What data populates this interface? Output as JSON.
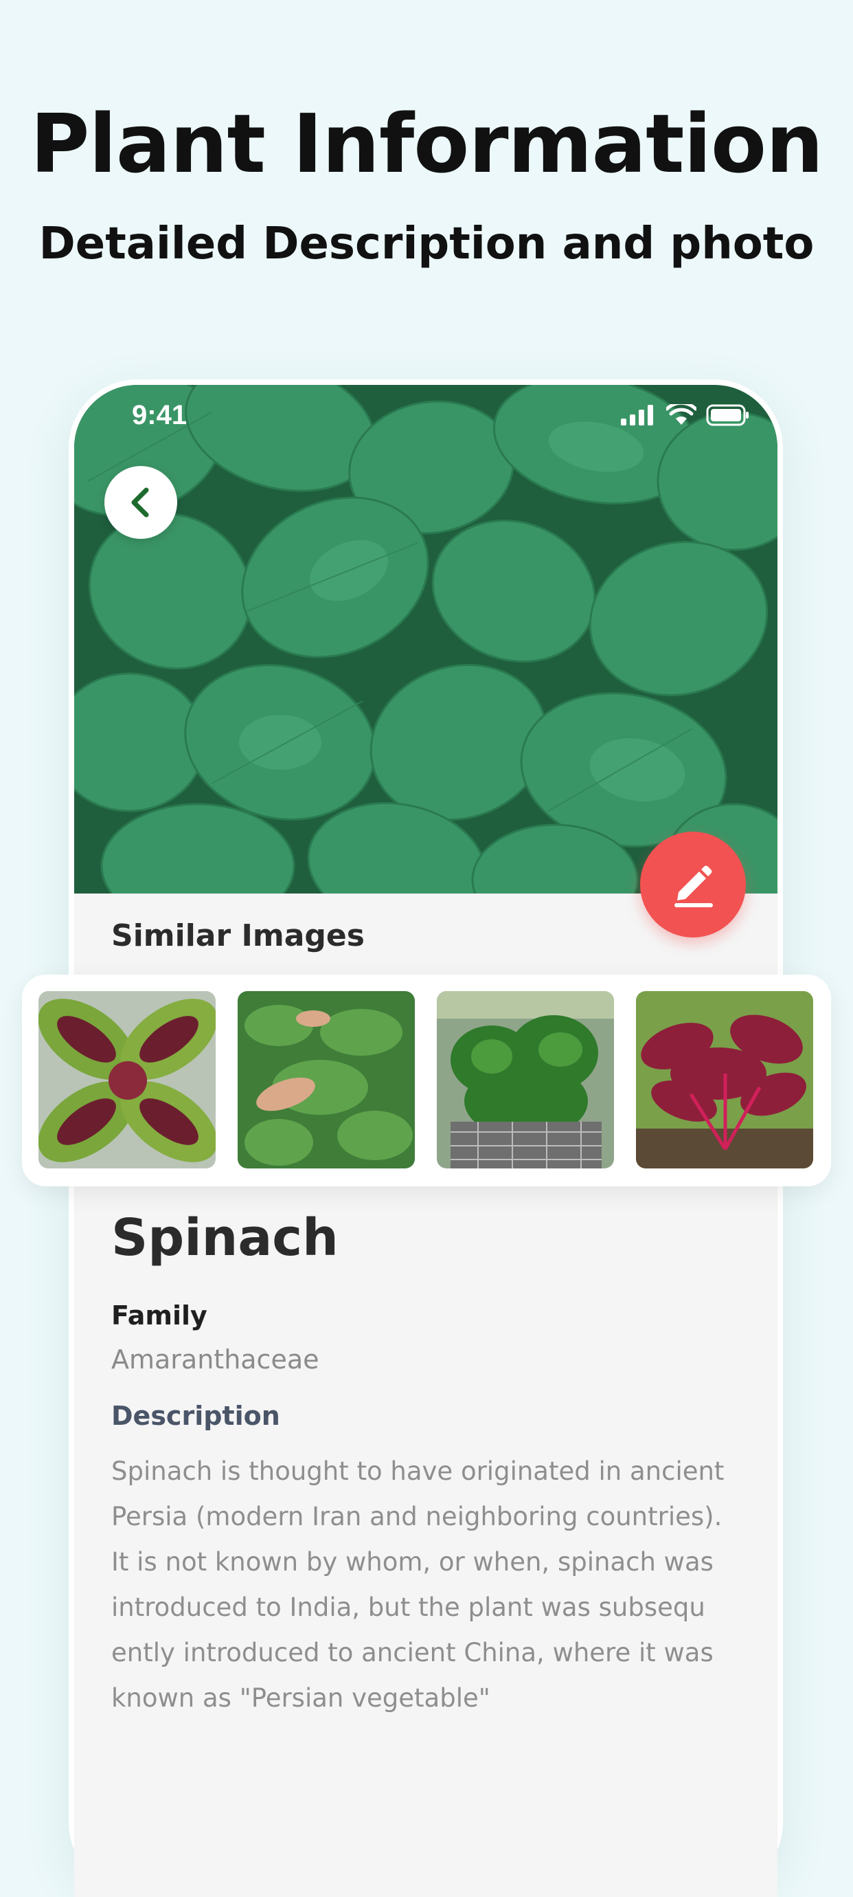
{
  "promo": {
    "headline": "Plant Information",
    "subheadline": "Detailed Description and photo"
  },
  "status_bar": {
    "time": "9:41",
    "icons": [
      "cellular-signal-icon",
      "wifi-icon",
      "battery-icon"
    ]
  },
  "icons": {
    "back": "chevron-left-icon",
    "edit": "pencil-icon"
  },
  "similar_images": {
    "title": "Similar Images",
    "items": [
      {
        "label": "red-green amaranth leaves"
      },
      {
        "label": "spinach harvest in hands"
      },
      {
        "label": "spinach in wire basket"
      },
      {
        "label": "red amaranth plant"
      }
    ]
  },
  "plant": {
    "name": "Spinach",
    "family_label": "Family",
    "family_value": "Amaranthaceae",
    "description_label": "Description",
    "description_lines": [
      "Spinach is thought to have originated in ancient",
      "Persia (modern Iran and neighboring countries).",
      "It is not known by whom, or when, spinach was",
      "introduced to India, but the plant was subsequ",
      "ently introduced to ancient China, where it was",
      "known as \"Persian vegetable\""
    ]
  },
  "colors": {
    "background": "#ECF8F9",
    "accent_fab": "#F25252",
    "back_icon": "#1E6B2E",
    "screen_bg": "#F5F5F5"
  }
}
